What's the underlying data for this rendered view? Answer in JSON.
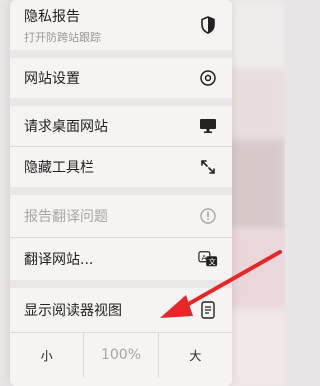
{
  "menu": {
    "privacy_report": {
      "label": "隐私报告",
      "sublabel": "打开防跨站跟踪"
    },
    "website_settings": "网站设置",
    "request_desktop": "请求桌面网站",
    "hide_toolbar": "隐藏工具栏",
    "report_translation": "报告翻译问题",
    "translate_site": "翻译网站...",
    "show_reader": "显示阅读器视图"
  },
  "zoom": {
    "decrease": "小",
    "level": "100%",
    "increase": "大"
  },
  "annotation": {
    "arrow_color": "#e8262a"
  }
}
